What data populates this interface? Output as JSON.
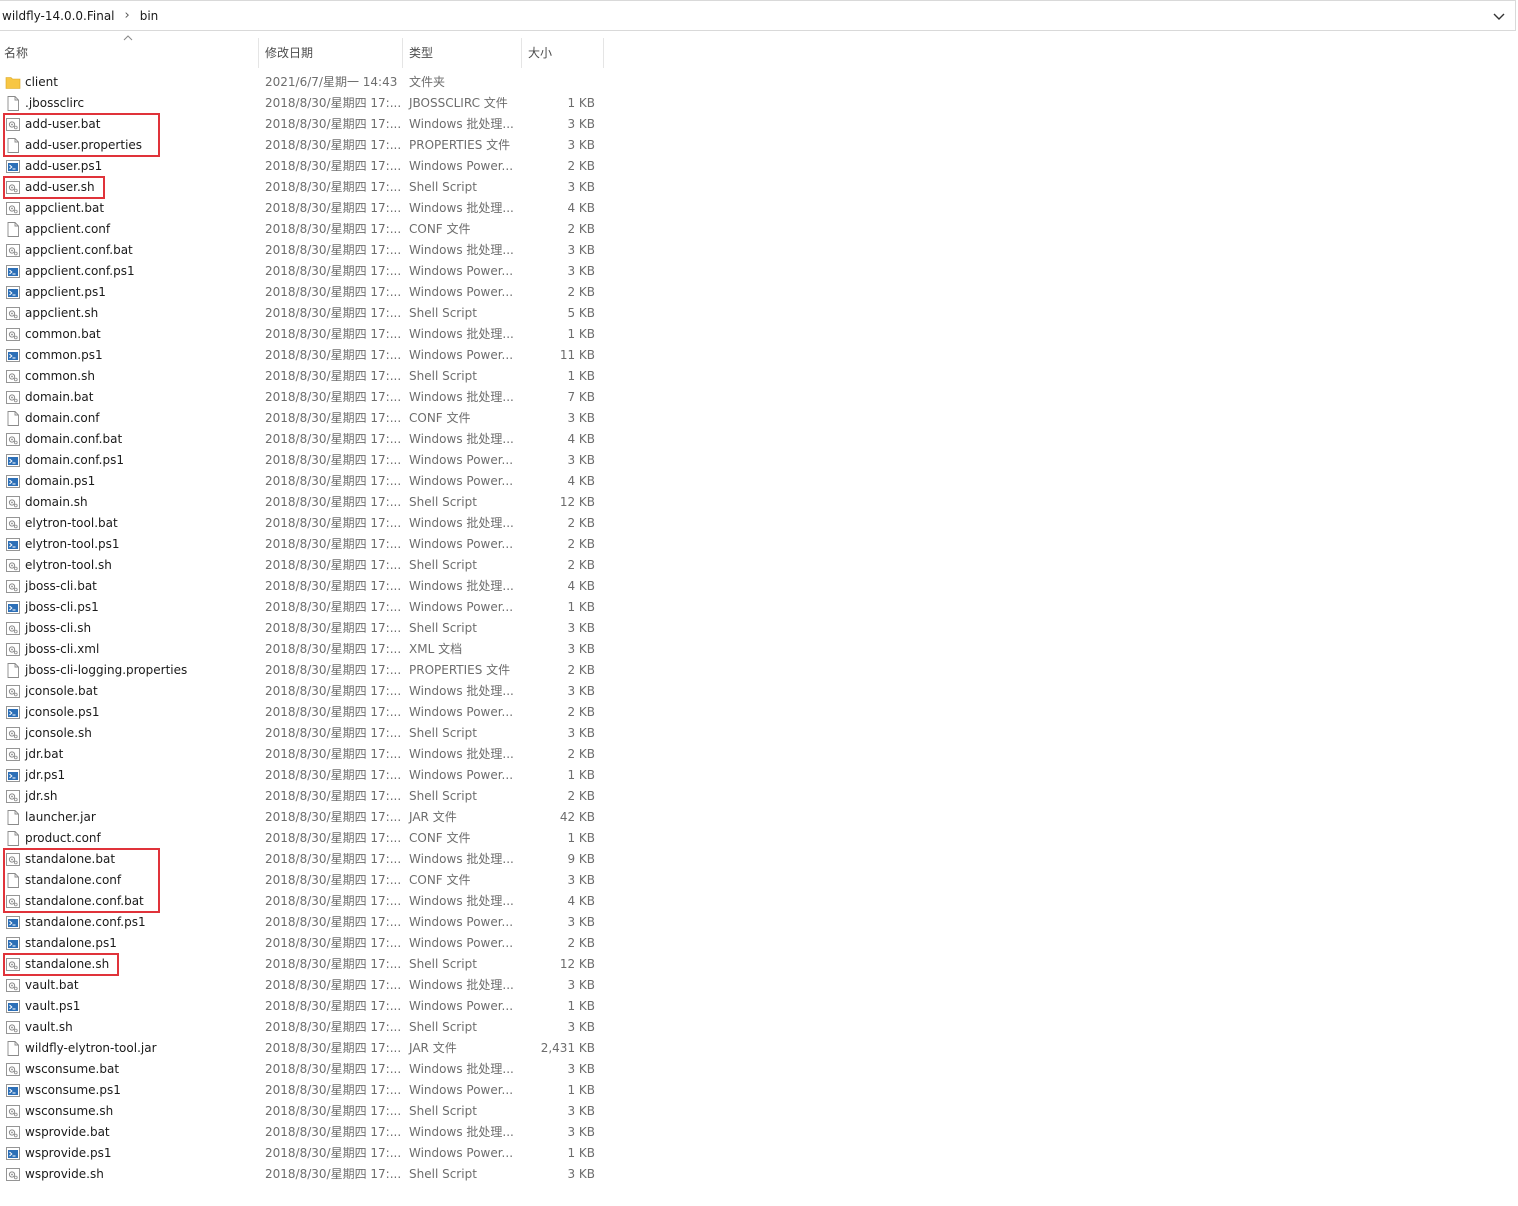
{
  "breadcrumb": {
    "items": [
      "wildfly-14.0.0.Final",
      "bin"
    ]
  },
  "columns": {
    "name": "名称",
    "date": "修改日期",
    "type": "类型",
    "size": "大小"
  },
  "icons": {
    "folder": "folder-icon",
    "text": "text-file-icon",
    "batch": "batch-file-icon",
    "powershell": "powershell-file-icon"
  },
  "files": [
    {
      "name": "client",
      "date": "2021/6/7/星期一 14:43",
      "type": "文件夹",
      "size": "",
      "icon": "folder"
    },
    {
      "name": ".jbossclirc",
      "date": "2018/8/30/星期四 17:...",
      "type": "JBOSSCLIRC 文件",
      "size": "1 KB",
      "icon": "text"
    },
    {
      "name": "add-user.bat",
      "date": "2018/8/30/星期四 17:...",
      "type": "Windows 批处理...",
      "size": "3 KB",
      "icon": "batch",
      "highlighted": true
    },
    {
      "name": "add-user.properties",
      "date": "2018/8/30/星期四 17:...",
      "type": "PROPERTIES 文件",
      "size": "3 KB",
      "icon": "text",
      "highlighted": true
    },
    {
      "name": "add-user.ps1",
      "date": "2018/8/30/星期四 17:...",
      "type": "Windows Power...",
      "size": "2 KB",
      "icon": "powershell"
    },
    {
      "name": "add-user.sh",
      "date": "2018/8/30/星期四 17:...",
      "type": "Shell Script",
      "size": "3 KB",
      "icon": "batch",
      "highlighted": true
    },
    {
      "name": "appclient.bat",
      "date": "2018/8/30/星期四 17:...",
      "type": "Windows 批处理...",
      "size": "4 KB",
      "icon": "batch"
    },
    {
      "name": "appclient.conf",
      "date": "2018/8/30/星期四 17:...",
      "type": "CONF 文件",
      "size": "2 KB",
      "icon": "text"
    },
    {
      "name": "appclient.conf.bat",
      "date": "2018/8/30/星期四 17:...",
      "type": "Windows 批处理...",
      "size": "3 KB",
      "icon": "batch"
    },
    {
      "name": "appclient.conf.ps1",
      "date": "2018/8/30/星期四 17:...",
      "type": "Windows Power...",
      "size": "3 KB",
      "icon": "powershell"
    },
    {
      "name": "appclient.ps1",
      "date": "2018/8/30/星期四 17:...",
      "type": "Windows Power...",
      "size": "2 KB",
      "icon": "powershell"
    },
    {
      "name": "appclient.sh",
      "date": "2018/8/30/星期四 17:...",
      "type": "Shell Script",
      "size": "5 KB",
      "icon": "batch"
    },
    {
      "name": "common.bat",
      "date": "2018/8/30/星期四 17:...",
      "type": "Windows 批处理...",
      "size": "1 KB",
      "icon": "batch"
    },
    {
      "name": "common.ps1",
      "date": "2018/8/30/星期四 17:...",
      "type": "Windows Power...",
      "size": "11 KB",
      "icon": "powershell"
    },
    {
      "name": "common.sh",
      "date": "2018/8/30/星期四 17:...",
      "type": "Shell Script",
      "size": "1 KB",
      "icon": "batch"
    },
    {
      "name": "domain.bat",
      "date": "2018/8/30/星期四 17:...",
      "type": "Windows 批处理...",
      "size": "7 KB",
      "icon": "batch"
    },
    {
      "name": "domain.conf",
      "date": "2018/8/30/星期四 17:...",
      "type": "CONF 文件",
      "size": "3 KB",
      "icon": "text"
    },
    {
      "name": "domain.conf.bat",
      "date": "2018/8/30/星期四 17:...",
      "type": "Windows 批处理...",
      "size": "4 KB",
      "icon": "batch"
    },
    {
      "name": "domain.conf.ps1",
      "date": "2018/8/30/星期四 17:...",
      "type": "Windows Power...",
      "size": "3 KB",
      "icon": "powershell"
    },
    {
      "name": "domain.ps1",
      "date": "2018/8/30/星期四 17:...",
      "type": "Windows Power...",
      "size": "4 KB",
      "icon": "powershell"
    },
    {
      "name": "domain.sh",
      "date": "2018/8/30/星期四 17:...",
      "type": "Shell Script",
      "size": "12 KB",
      "icon": "batch"
    },
    {
      "name": "elytron-tool.bat",
      "date": "2018/8/30/星期四 17:...",
      "type": "Windows 批处理...",
      "size": "2 KB",
      "icon": "batch"
    },
    {
      "name": "elytron-tool.ps1",
      "date": "2018/8/30/星期四 17:...",
      "type": "Windows Power...",
      "size": "2 KB",
      "icon": "powershell"
    },
    {
      "name": "elytron-tool.sh",
      "date": "2018/8/30/星期四 17:...",
      "type": "Shell Script",
      "size": "2 KB",
      "icon": "batch"
    },
    {
      "name": "jboss-cli.bat",
      "date": "2018/8/30/星期四 17:...",
      "type": "Windows 批处理...",
      "size": "4 KB",
      "icon": "batch"
    },
    {
      "name": "jboss-cli.ps1",
      "date": "2018/8/30/星期四 17:...",
      "type": "Windows Power...",
      "size": "1 KB",
      "icon": "powershell"
    },
    {
      "name": "jboss-cli.sh",
      "date": "2018/8/30/星期四 17:...",
      "type": "Shell Script",
      "size": "3 KB",
      "icon": "batch"
    },
    {
      "name": "jboss-cli.xml",
      "date": "2018/8/30/星期四 17:...",
      "type": "XML 文档",
      "size": "3 KB",
      "icon": "batch"
    },
    {
      "name": "jboss-cli-logging.properties",
      "date": "2018/8/30/星期四 17:...",
      "type": "PROPERTIES 文件",
      "size": "2 KB",
      "icon": "text"
    },
    {
      "name": "jconsole.bat",
      "date": "2018/8/30/星期四 17:...",
      "type": "Windows 批处理...",
      "size": "3 KB",
      "icon": "batch"
    },
    {
      "name": "jconsole.ps1",
      "date": "2018/8/30/星期四 17:...",
      "type": "Windows Power...",
      "size": "2 KB",
      "icon": "powershell"
    },
    {
      "name": "jconsole.sh",
      "date": "2018/8/30/星期四 17:...",
      "type": "Shell Script",
      "size": "3 KB",
      "icon": "batch"
    },
    {
      "name": "jdr.bat",
      "date": "2018/8/30/星期四 17:...",
      "type": "Windows 批处理...",
      "size": "2 KB",
      "icon": "batch"
    },
    {
      "name": "jdr.ps1",
      "date": "2018/8/30/星期四 17:...",
      "type": "Windows Power...",
      "size": "1 KB",
      "icon": "powershell"
    },
    {
      "name": "jdr.sh",
      "date": "2018/8/30/星期四 17:...",
      "type": "Shell Script",
      "size": "2 KB",
      "icon": "batch"
    },
    {
      "name": "launcher.jar",
      "date": "2018/8/30/星期四 17:...",
      "type": "JAR 文件",
      "size": "42 KB",
      "icon": "text"
    },
    {
      "name": "product.conf",
      "date": "2018/8/30/星期四 17:...",
      "type": "CONF 文件",
      "size": "1 KB",
      "icon": "text"
    },
    {
      "name": "standalone.bat",
      "date": "2018/8/30/星期四 17:...",
      "type": "Windows 批处理...",
      "size": "9 KB",
      "icon": "batch",
      "highlighted": true
    },
    {
      "name": "standalone.conf",
      "date": "2018/8/30/星期四 17:...",
      "type": "CONF 文件",
      "size": "3 KB",
      "icon": "text",
      "highlighted": true
    },
    {
      "name": "standalone.conf.bat",
      "date": "2018/8/30/星期四 17:...",
      "type": "Windows 批处理...",
      "size": "4 KB",
      "icon": "batch",
      "highlighted": true
    },
    {
      "name": "standalone.conf.ps1",
      "date": "2018/8/30/星期四 17:...",
      "type": "Windows Power...",
      "size": "3 KB",
      "icon": "powershell"
    },
    {
      "name": "standalone.ps1",
      "date": "2018/8/30/星期四 17:...",
      "type": "Windows Power...",
      "size": "2 KB",
      "icon": "powershell"
    },
    {
      "name": "standalone.sh",
      "date": "2018/8/30/星期四 17:...",
      "type": "Shell Script",
      "size": "12 KB",
      "icon": "batch",
      "highlighted": true
    },
    {
      "name": "vault.bat",
      "date": "2018/8/30/星期四 17:...",
      "type": "Windows 批处理...",
      "size": "3 KB",
      "icon": "batch"
    },
    {
      "name": "vault.ps1",
      "date": "2018/8/30/星期四 17:...",
      "type": "Windows Power...",
      "size": "1 KB",
      "icon": "powershell"
    },
    {
      "name": "vault.sh",
      "date": "2018/8/30/星期四 17:...",
      "type": "Shell Script",
      "size": "3 KB",
      "icon": "batch"
    },
    {
      "name": "wildfly-elytron-tool.jar",
      "date": "2018/8/30/星期四 17:...",
      "type": "JAR 文件",
      "size": "2,431 KB",
      "icon": "text"
    },
    {
      "name": "wsconsume.bat",
      "date": "2018/8/30/星期四 17:...",
      "type": "Windows 批处理...",
      "size": "3 KB",
      "icon": "batch"
    },
    {
      "name": "wsconsume.ps1",
      "date": "2018/8/30/星期四 17:...",
      "type": "Windows Power...",
      "size": "1 KB",
      "icon": "powershell"
    },
    {
      "name": "wsconsume.sh",
      "date": "2018/8/30/星期四 17:...",
      "type": "Shell Script",
      "size": "3 KB",
      "icon": "batch"
    },
    {
      "name": "wsprovide.bat",
      "date": "2018/8/30/星期四 17:...",
      "type": "Windows 批处理...",
      "size": "3 KB",
      "icon": "batch"
    },
    {
      "name": "wsprovide.ps1",
      "date": "2018/8/30/星期四 17:...",
      "type": "Windows Power...",
      "size": "1 KB",
      "icon": "powershell"
    },
    {
      "name": "wsprovide.sh",
      "date": "2018/8/30/星期四 17:...",
      "type": "Shell Script",
      "size": "3 KB",
      "icon": "batch"
    }
  ],
  "colors": {
    "highlight": "#e0333a",
    "folder": "#f7c644",
    "powershell": "#2c6fb7"
  }
}
